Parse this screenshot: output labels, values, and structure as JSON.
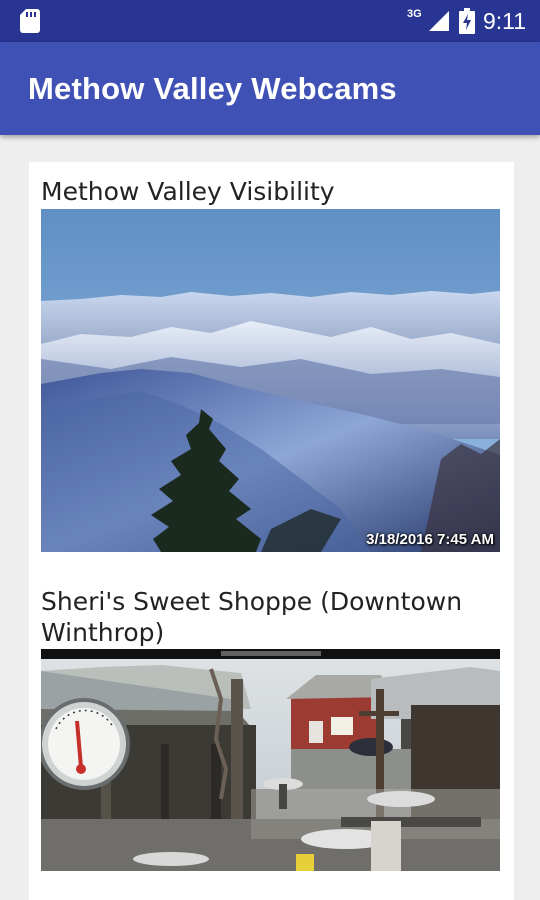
{
  "status_bar": {
    "network": "3G",
    "time": "9:11",
    "icons": [
      "sd-card-icon",
      "signal-icon",
      "battery-charging-icon"
    ]
  },
  "app_bar": {
    "title": "Methow Valley Webcams"
  },
  "webcams": [
    {
      "title": "Methow Valley Visibility",
      "timestamp": "3/18/2016 7:45 AM"
    },
    {
      "title": "Sheri's Sweet Shoppe (Downtown Winthrop)"
    }
  ],
  "colors": {
    "status_bar": "#283593",
    "app_bar": "#3f51b5",
    "background": "#eeeeee"
  }
}
